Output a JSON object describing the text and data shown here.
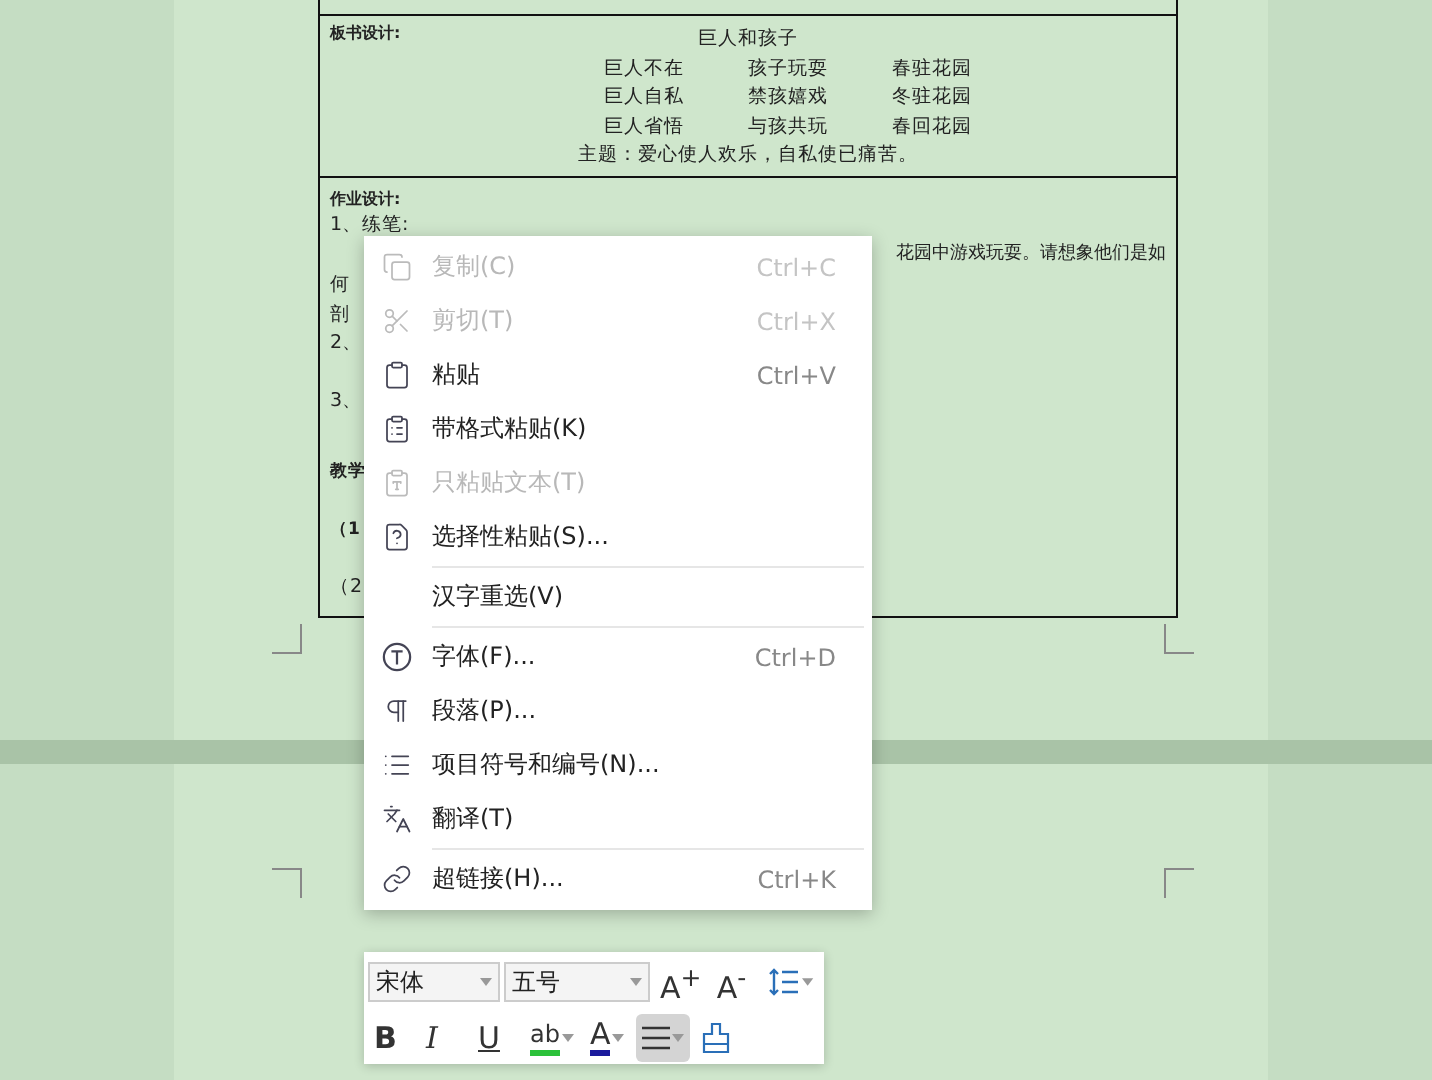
{
  "document": {
    "board_design": {
      "label": "板书设计:",
      "title": "巨人和孩子",
      "rows": [
        [
          "巨人不在",
          "孩子玩耍",
          "春驻花园"
        ],
        [
          "巨人自私",
          "禁孩嬉戏",
          "冬驻花园"
        ],
        [
          "巨人省悟",
          "与孩共玩",
          "春回花园"
        ]
      ],
      "theme": "主题：爱心使人欢乐，自私使已痛苦。"
    },
    "homework": {
      "label": "作业设计:",
      "lines": [
        {
          "left": "1、练笔:"
        },
        {
          "right": "花园中游戏玩耍。请想象他们是如"
        },
        {
          "left": "何"
        },
        {
          "left": "剖"
        },
        {
          "left": "2、"
        },
        {
          "left": "3、"
        },
        {
          "left": "教学",
          "bold": true
        },
        {
          "left": "（1",
          "bold": true
        },
        {
          "left": "（2"
        }
      ]
    }
  },
  "context_menu": {
    "groups": [
      [
        {
          "kind": "copy",
          "label": "复制(C)",
          "shortcut": "Ctrl+C",
          "disabled": true
        },
        {
          "kind": "cut",
          "label": "剪切(T)",
          "shortcut": "Ctrl+X",
          "disabled": true
        },
        {
          "kind": "paste",
          "label": "粘贴",
          "shortcut": "Ctrl+V",
          "disabled": false
        },
        {
          "kind": "paste-format",
          "label": "带格式粘贴(K)",
          "disabled": false
        },
        {
          "kind": "paste-text",
          "label": "只粘贴文本(T)",
          "disabled": true
        },
        {
          "kind": "paste-special",
          "label": "选择性粘贴(S)...",
          "disabled": false
        }
      ],
      [
        {
          "kind": "none",
          "label": "汉字重选(V)",
          "disabled": false
        }
      ],
      [
        {
          "kind": "font",
          "label": "字体(F)...",
          "shortcut": "Ctrl+D",
          "disabled": false
        },
        {
          "kind": "paragraph",
          "label": "段落(P)...",
          "disabled": false
        },
        {
          "kind": "bullets",
          "label": "项目符号和编号(N)...",
          "disabled": false
        },
        {
          "kind": "translate",
          "label": "翻译(T)",
          "disabled": false
        }
      ],
      [
        {
          "kind": "link",
          "label": "超链接(H)...",
          "shortcut": "Ctrl+K",
          "disabled": false
        }
      ]
    ]
  },
  "mini_toolbar": {
    "font": "宋体",
    "size": "五号",
    "row1": [
      {
        "kind": "grow",
        "label": "A$^{+}$"
      },
      {
        "kind": "shrink",
        "label": "A$^{-}$"
      },
      {
        "kind": "spacing"
      }
    ],
    "row2": [
      {
        "kind": "bold",
        "label": "B",
        "pressed": false
      },
      {
        "kind": "italic",
        "label": "I",
        "pressed": false
      },
      {
        "kind": "underline",
        "label": "U",
        "pressed": false
      },
      {
        "kind": "highlight",
        "label": "ab",
        "pressed": false
      },
      {
        "kind": "color",
        "label": "A",
        "pressed": false
      },
      {
        "kind": "align",
        "pressed": true
      },
      {
        "kind": "eraser",
        "pressed": false
      }
    ]
  }
}
